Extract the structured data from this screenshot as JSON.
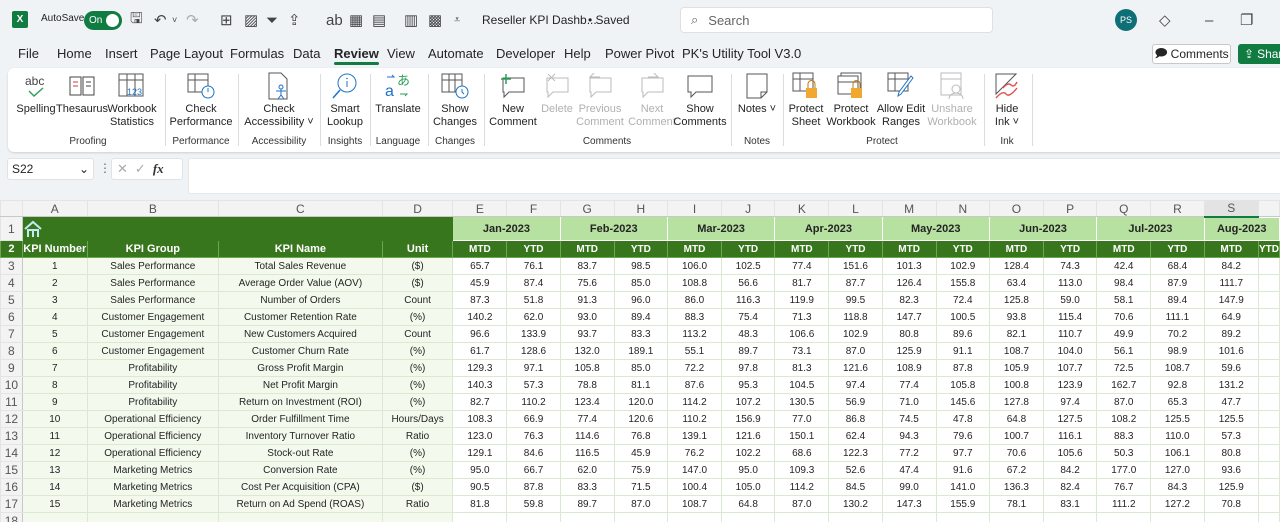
{
  "titlebar": {
    "app_icon": "excel-logo-icon",
    "autosave_label": "AutoSave",
    "autosave_state": "On",
    "doc_title": "Reseller KPI Dashb...",
    "save_state": "• Saved",
    "search_placeholder": "Search",
    "user_initials": "PS"
  },
  "menu": {
    "items": [
      "File",
      "Home",
      "Insert",
      "Page Layout",
      "Formulas",
      "Data",
      "Review",
      "View",
      "Automate",
      "Developer",
      "Help",
      "Power Pivot",
      "PK's Utility Tool V3.0"
    ],
    "active": "Review",
    "comments_label": "Comments",
    "share_label": "Share"
  },
  "ribbon": {
    "groups": [
      {
        "label": "Proofing",
        "buttons": [
          {
            "label": "Spelling",
            "icon": "spelling-icon"
          },
          {
            "label": "Thesaurus",
            "icon": "thesaurus-icon"
          },
          {
            "label": "Workbook Statistics",
            "icon": "workbook-statistics-icon"
          }
        ]
      },
      {
        "label": "Performance",
        "buttons": [
          {
            "label": "Check Performance",
            "icon": "check-performance-icon"
          }
        ]
      },
      {
        "label": "Accessibility",
        "buttons": [
          {
            "label": "Check Accessibility ˅",
            "icon": "check-accessibility-icon"
          }
        ]
      },
      {
        "label": "Insights",
        "buttons": [
          {
            "label": "Smart Lookup",
            "icon": "smart-lookup-icon"
          }
        ]
      },
      {
        "label": "Language",
        "buttons": [
          {
            "label": "Translate",
            "icon": "translate-icon"
          }
        ]
      },
      {
        "label": "Changes",
        "buttons": [
          {
            "label": "Show Changes",
            "icon": "show-changes-icon"
          }
        ]
      },
      {
        "label": "Comments",
        "buttons": [
          {
            "label": "New Comment",
            "icon": "new-comment-icon"
          },
          {
            "label": "Delete",
            "icon": "delete-comment-icon",
            "disabled": true
          },
          {
            "label": "Previous Comment",
            "icon": "previous-comment-icon",
            "disabled": true
          },
          {
            "label": "Next Comment",
            "icon": "next-comment-icon",
            "disabled": true
          },
          {
            "label": "Show Comments",
            "icon": "show-comments-icon"
          }
        ]
      },
      {
        "label": "Notes",
        "buttons": [
          {
            "label": "Notes ˅",
            "icon": "notes-icon"
          }
        ]
      },
      {
        "label": "Protect",
        "buttons": [
          {
            "label": "Protect Sheet",
            "icon": "protect-sheet-icon"
          },
          {
            "label": "Protect Workbook",
            "icon": "protect-workbook-icon"
          },
          {
            "label": "Allow Edit Ranges",
            "icon": "allow-edit-ranges-icon"
          },
          {
            "label": "Unshare Workbook",
            "icon": "unshare-workbook-icon",
            "disabled": true
          }
        ]
      },
      {
        "label": "Ink",
        "buttons": [
          {
            "label": "Hide Ink ˅",
            "icon": "hide-ink-icon"
          }
        ]
      }
    ]
  },
  "formula_bar": {
    "name_box": "S22",
    "fx_label": "fx",
    "formula": ""
  },
  "sheet": {
    "columns": [
      "A",
      "B",
      "C",
      "D",
      "E",
      "F",
      "G",
      "H",
      "I",
      "J",
      "K",
      "L",
      "M",
      "N",
      "O",
      "P",
      "Q",
      "R",
      "S"
    ],
    "selected_column": "S",
    "months": [
      "Jan-2023",
      "Feb-2023",
      "Mar-2023",
      "Apr-2023",
      "May-2023",
      "Jun-2023",
      "Jul-2023",
      "Aug-2023"
    ],
    "headers": [
      "KPI Number",
      "KPI Group",
      "KPI Name",
      "Unit"
    ],
    "sub_headers": [
      "MTD",
      "YTD"
    ],
    "rows": [
      {
        "num": "1",
        "group": "Sales Performance",
        "name": "Total Sales Revenue",
        "unit": "($)",
        "values": [
          "65.7",
          "76.1",
          "83.7",
          "98.5",
          "106.0",
          "102.5",
          "77.4",
          "151.6",
          "101.3",
          "102.9",
          "128.4",
          "74.3",
          "42.4",
          "68.4",
          "84.2"
        ]
      },
      {
        "num": "2",
        "group": "Sales Performance",
        "name": "Average Order Value (AOV)",
        "unit": "($)",
        "values": [
          "45.9",
          "87.4",
          "75.6",
          "85.0",
          "108.8",
          "56.6",
          "81.7",
          "87.7",
          "126.4",
          "155.8",
          "63.4",
          "113.0",
          "98.4",
          "87.9",
          "111.7"
        ]
      },
      {
        "num": "3",
        "group": "Sales Performance",
        "name": "Number of Orders",
        "unit": "Count",
        "values": [
          "87.3",
          "51.8",
          "91.3",
          "96.0",
          "86.0",
          "116.3",
          "119.9",
          "99.5",
          "82.3",
          "72.4",
          "125.8",
          "59.0",
          "58.1",
          "89.4",
          "147.9"
        ]
      },
      {
        "num": "4",
        "group": "Customer Engagement",
        "name": "Customer Retention Rate",
        "unit": "(%)",
        "values": [
          "140.2",
          "62.0",
          "93.0",
          "89.4",
          "88.3",
          "75.4",
          "71.3",
          "118.8",
          "147.7",
          "100.5",
          "93.8",
          "115.4",
          "70.6",
          "111.1",
          "64.9"
        ]
      },
      {
        "num": "5",
        "group": "Customer Engagement",
        "name": "New Customers Acquired",
        "unit": "Count",
        "values": [
          "96.6",
          "133.9",
          "93.7",
          "83.3",
          "113.2",
          "48.3",
          "106.6",
          "102.9",
          "80.8",
          "89.6",
          "82.1",
          "110.7",
          "49.9",
          "70.2",
          "89.2"
        ]
      },
      {
        "num": "6",
        "group": "Customer Engagement",
        "name": "Customer Churn Rate",
        "unit": "(%)",
        "values": [
          "61.7",
          "128.6",
          "132.0",
          "189.1",
          "55.1",
          "89.7",
          "73.1",
          "87.0",
          "125.9",
          "91.1",
          "108.7",
          "104.0",
          "56.1",
          "98.9",
          "101.6"
        ]
      },
      {
        "num": "7",
        "group": "Profitability",
        "name": "Gross Profit Margin",
        "unit": "(%)",
        "values": [
          "129.3",
          "97.1",
          "105.8",
          "85.0",
          "72.2",
          "97.8",
          "81.3",
          "121.6",
          "108.9",
          "87.8",
          "105.9",
          "107.7",
          "72.5",
          "108.7",
          "59.6"
        ]
      },
      {
        "num": "8",
        "group": "Profitability",
        "name": "Net Profit Margin",
        "unit": "(%)",
        "values": [
          "140.3",
          "57.3",
          "78.8",
          "81.1",
          "87.6",
          "95.3",
          "104.5",
          "97.4",
          "77.4",
          "105.8",
          "100.8",
          "123.9",
          "162.7",
          "92.8",
          "131.2"
        ]
      },
      {
        "num": "9",
        "group": "Profitability",
        "name": "Return on Investment (ROI)",
        "unit": "(%)",
        "values": [
          "82.7",
          "110.2",
          "123.4",
          "120.0",
          "114.2",
          "107.2",
          "130.5",
          "56.9",
          "71.0",
          "145.6",
          "127.8",
          "97.4",
          "87.0",
          "65.3",
          "47.7"
        ]
      },
      {
        "num": "10",
        "group": "Operational Efficiency",
        "name": "Order Fulfillment Time",
        "unit": "Hours/Days",
        "values": [
          "108.3",
          "66.9",
          "77.4",
          "120.6",
          "110.2",
          "156.9",
          "77.0",
          "86.8",
          "74.5",
          "47.8",
          "64.8",
          "127.5",
          "108.2",
          "125.5",
          "125.5"
        ]
      },
      {
        "num": "11",
        "group": "Operational Efficiency",
        "name": "Inventory Turnover Ratio",
        "unit": "Ratio",
        "values": [
          "123.0",
          "76.3",
          "114.6",
          "76.8",
          "139.1",
          "121.6",
          "150.1",
          "62.4",
          "94.3",
          "79.6",
          "100.7",
          "116.1",
          "88.3",
          "110.0",
          "57.3"
        ]
      },
      {
        "num": "12",
        "group": "Operational Efficiency",
        "name": "Stock-out Rate",
        "unit": "(%)",
        "values": [
          "129.1",
          "84.6",
          "116.5",
          "45.9",
          "76.2",
          "102.2",
          "68.6",
          "122.3",
          "77.2",
          "97.7",
          "70.6",
          "105.6",
          "50.3",
          "106.1",
          "80.8"
        ]
      },
      {
        "num": "13",
        "group": "Marketing Metrics",
        "name": "Conversion Rate",
        "unit": "(%)",
        "values": [
          "95.0",
          "66.7",
          "62.0",
          "75.9",
          "147.0",
          "95.0",
          "109.3",
          "52.6",
          "47.4",
          "91.6",
          "67.2",
          "84.2",
          "177.0",
          "127.0",
          "93.6"
        ]
      },
      {
        "num": "14",
        "group": "Marketing Metrics",
        "name": "Cost Per Acquisition (CPA)",
        "unit": "($)",
        "values": [
          "90.5",
          "87.8",
          "83.3",
          "71.5",
          "100.4",
          "105.0",
          "114.2",
          "84.5",
          "99.0",
          "141.0",
          "136.3",
          "82.4",
          "76.7",
          "84.3",
          "125.9"
        ]
      },
      {
        "num": "15",
        "group": "Marketing Metrics",
        "name": "Return on Ad Spend (ROAS)",
        "unit": "Ratio",
        "values": [
          "81.8",
          "59.8",
          "89.7",
          "87.0",
          "108.7",
          "64.8",
          "87.0",
          "130.2",
          "147.3",
          "155.9",
          "78.1",
          "83.1",
          "111.2",
          "127.2",
          "70.8"
        ]
      }
    ]
  }
}
